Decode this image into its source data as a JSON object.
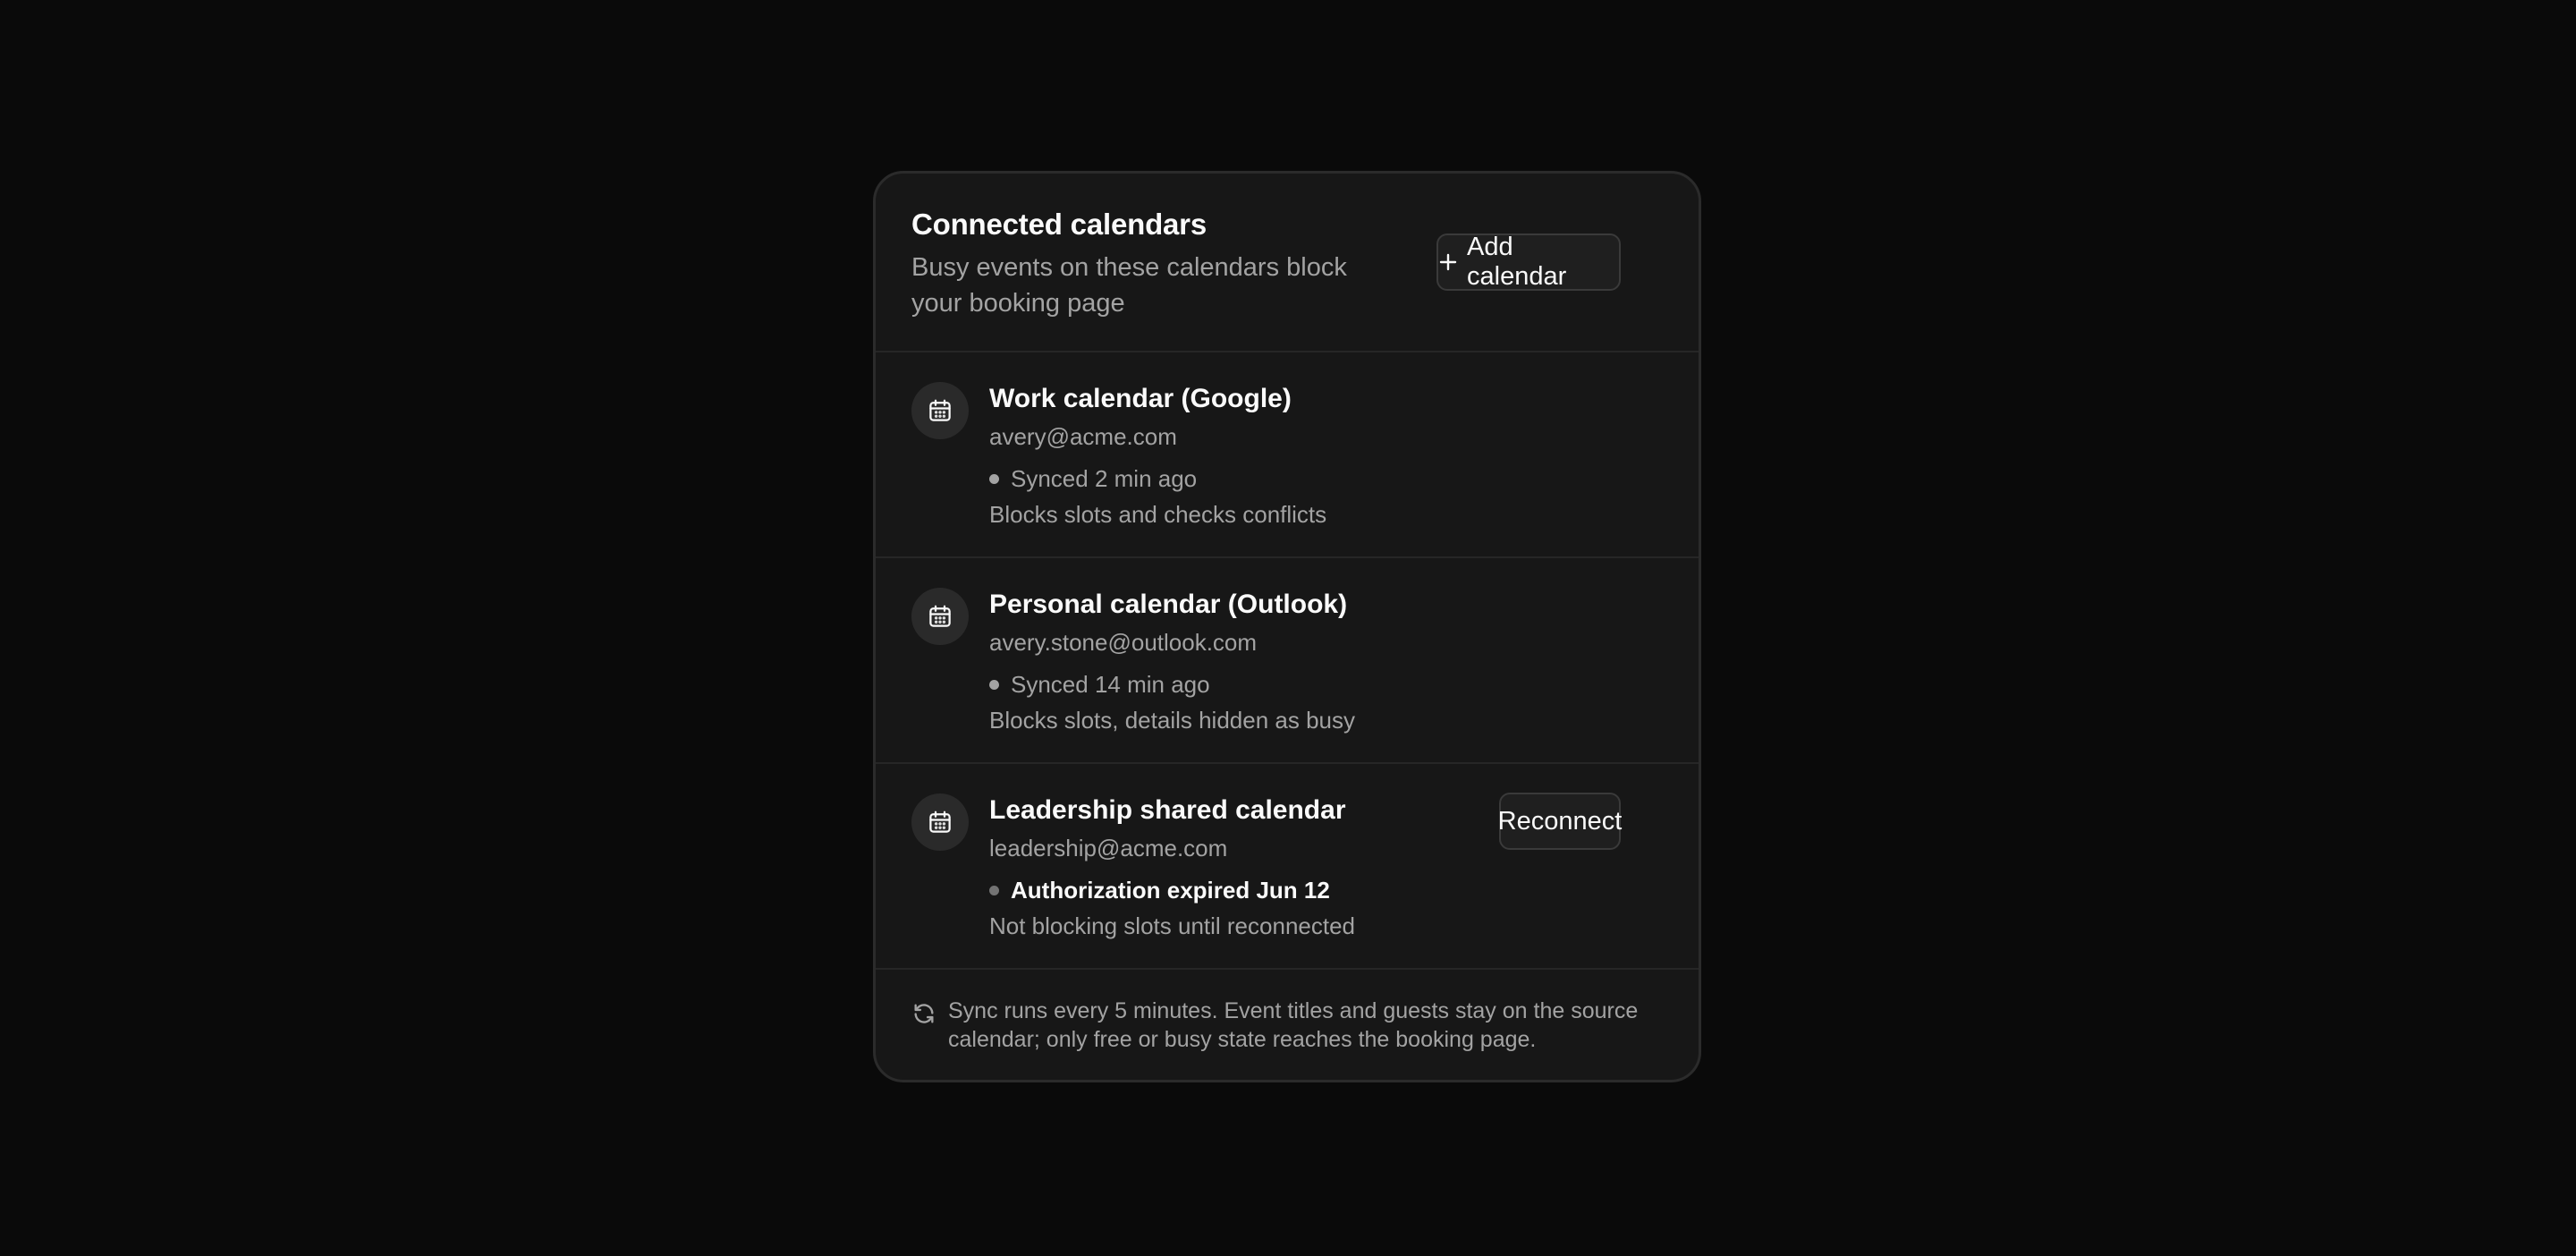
{
  "header": {
    "title": "Connected calendars",
    "subtitle": "Busy events on these calendars block your booking page",
    "add_button_label": "Add calendar"
  },
  "calendars": [
    {
      "name": "Work calendar (Google)",
      "email": "avery@acme.com",
      "status": "Synced 2 min ago",
      "note": "Blocks slots and checks conflicts"
    },
    {
      "name": "Personal calendar (Outlook)",
      "email": "avery.stone@outlook.com",
      "status": "Synced 14 min ago",
      "note": "Blocks slots, details hidden as busy"
    },
    {
      "name": "Leadership shared calendar",
      "email": "leadership@acme.com",
      "status": "Authorization expired Jun 12",
      "note": "Not blocking slots until reconnected",
      "action_label": "Reconnect"
    }
  ],
  "footer": {
    "note": "Sync runs every 5 minutes. Event titles and guests stay on the source calendar; only free or busy state reaches the booking page."
  },
  "icons": {
    "add": "plus-icon",
    "calendar": "calendar-icon",
    "sync": "refresh-icon"
  },
  "colors": {
    "background": "#0a0a0a",
    "card": "#171717",
    "text": "#fafafa",
    "muted": "#a3a3a3"
  }
}
